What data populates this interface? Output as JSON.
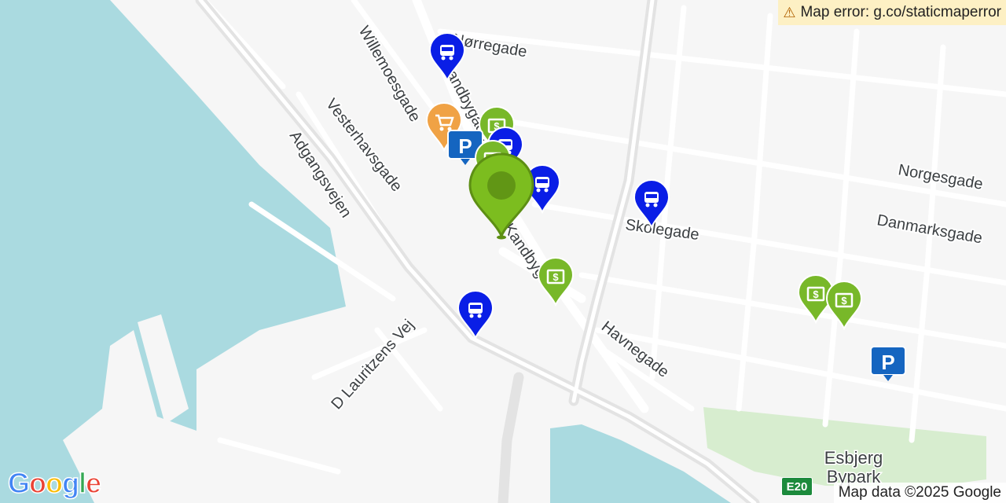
{
  "map": {
    "colors": {
      "water": "#aadae0",
      "land": "#f6f6f6",
      "park": "#d7edcf",
      "road": "#ffffff",
      "major_road": "#e3e3e3",
      "bus": "#0a1ee6",
      "finance": "#78b829",
      "shopping": "#f0a245",
      "parking": "#1565c0",
      "selected_pin": "#7cbd1f"
    },
    "labels": {
      "norregade": "Nørregade",
      "willemoesgade": "Willemoesgade",
      "vesterhavsgade": "Vesterhavsgade",
      "adgangsvejen": "Adgangsvejen",
      "torvegade_top": "Kandbygade",
      "torvegade_bottom": "Kandbygade",
      "skolegade": "Skolegade",
      "norgesgade": "Norgesgade",
      "danmarksgade": "Danmarksgade",
      "havnegade": "Havnegade",
      "d_lauritzens_vej": "D Lauritzens Vej",
      "park_line1": "Esbjerg",
      "park_line2": "Bypark"
    },
    "road_shield": "E20",
    "error_text": "Map error: g.co/staticmaperror",
    "attribution": "Map data ©2025 Google",
    "logo": {
      "letters": [
        "G",
        "o",
        "o",
        "g",
        "l",
        "e"
      ],
      "colors": [
        "#4285f4",
        "#ea4335",
        "#fbbc05",
        "#4285f4",
        "#34a853",
        "#ea4335"
      ]
    },
    "markers": [
      {
        "type": "bus",
        "icon": "bus-icon"
      },
      {
        "type": "shopping",
        "icon": "cart-icon"
      },
      {
        "type": "finance",
        "icon": "atm-icon"
      },
      {
        "type": "parking",
        "icon": "parking-icon"
      },
      {
        "type": "bus",
        "icon": "bus-icon"
      },
      {
        "type": "finance",
        "icon": "atm-icon"
      },
      {
        "type": "bus",
        "icon": "bus-icon"
      },
      {
        "type": "bus",
        "icon": "bus-icon"
      },
      {
        "type": "finance",
        "icon": "atm-icon"
      },
      {
        "type": "bus",
        "icon": "bus-icon"
      },
      {
        "type": "finance",
        "icon": "atm-icon"
      },
      {
        "type": "finance",
        "icon": "atm-icon"
      },
      {
        "type": "parking",
        "icon": "parking-icon"
      }
    ],
    "selected_marker": {
      "type": "selected",
      "icon": "location-pin-icon"
    }
  }
}
